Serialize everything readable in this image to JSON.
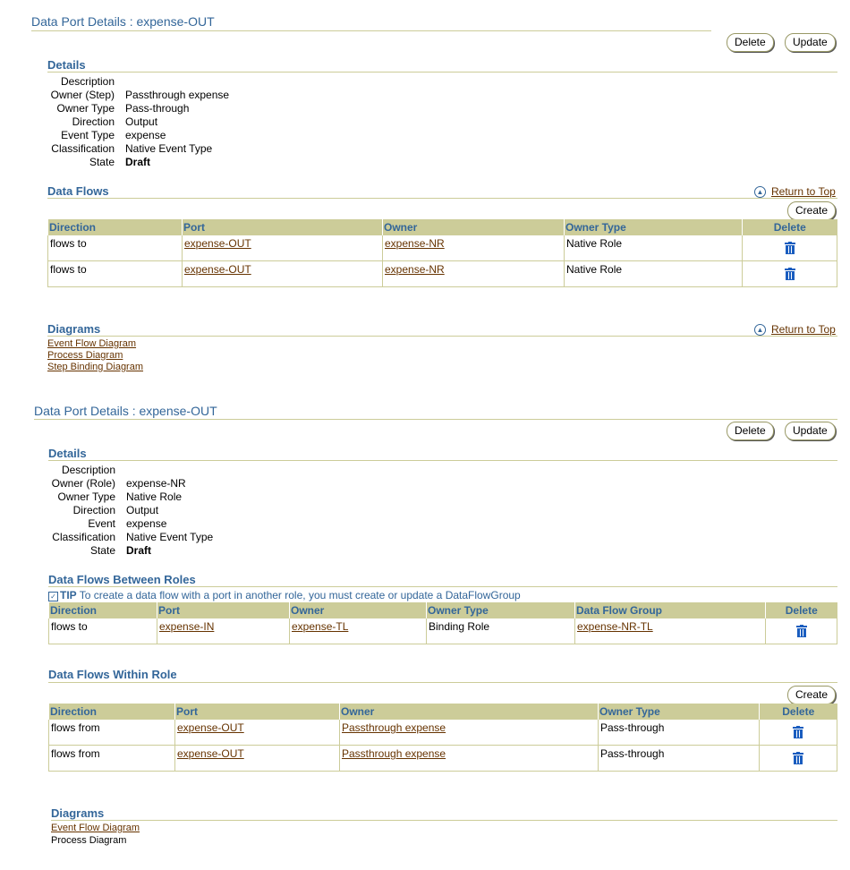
{
  "section1": {
    "page_title": "Data Port Details : expense-OUT",
    "delete_button": "Delete",
    "update_button": "Update",
    "details_title": "Details",
    "details": [
      {
        "label": "Description",
        "value": ""
      },
      {
        "label": "Owner (Step)",
        "value": "Passthrough expense"
      },
      {
        "label": "Owner Type",
        "value": "Pass-through"
      },
      {
        "label": "Direction",
        "value": "Output"
      },
      {
        "label": "Event Type",
        "value": "expense"
      },
      {
        "label": "Classification",
        "value": "Native Event Type"
      },
      {
        "label": "State",
        "value": "Draft"
      }
    ],
    "data_flows_title": "Data Flows",
    "return_to_top": "Return to Top",
    "create_button": "Create",
    "columns": [
      "Direction",
      "Port",
      "Owner",
      "Owner Type",
      "Delete"
    ],
    "rows": [
      {
        "direction": "flows to",
        "port": "expense-OUT",
        "owner": "expense-NR",
        "owner_type": "Native Role"
      },
      {
        "direction": "flows to",
        "port": "expense-OUT",
        "owner": "expense-NR",
        "owner_type": "Native Role"
      }
    ],
    "diagrams_title": "Diagrams",
    "diagrams_return_to_top": "Return to Top",
    "diagram_links": [
      "Event Flow Diagram",
      "Process Diagram",
      "Step Binding Diagram"
    ]
  },
  "section2": {
    "page_title": "Data Port Details : expense-OUT",
    "delete_button": "Delete",
    "update_button": "Update",
    "details_title": "Details",
    "details": [
      {
        "label": "Description",
        "value": ""
      },
      {
        "label": "Owner (Role)",
        "value": "expense-NR"
      },
      {
        "label": "Owner Type",
        "value": "Native Role"
      },
      {
        "label": "Direction",
        "value": "Output"
      },
      {
        "label": "Event",
        "value": "expense"
      },
      {
        "label": "Classification",
        "value": "Native Event Type"
      },
      {
        "label": "State",
        "value": "Draft"
      }
    ],
    "between_title": "Data Flows Between Roles",
    "tip_label": "TIP",
    "tip_text": "To create a data flow with a port in another role, you must create or update a DataFlowGroup",
    "between_columns": [
      "Direction",
      "Port",
      "Owner",
      "Owner Type",
      "Data Flow Group",
      "Delete"
    ],
    "between_rows": [
      {
        "direction": "flows to",
        "port": "expense-IN",
        "owner": "expense-TL",
        "owner_type": "Binding Role",
        "group": "expense-NR-TL"
      }
    ],
    "within_title": "Data Flows Within Role",
    "create_button": "Create",
    "within_columns": [
      "Direction",
      "Port",
      "Owner",
      "Owner Type",
      "Delete"
    ],
    "within_rows": [
      {
        "direction": "flows from",
        "port": "expense-OUT",
        "owner": "Passthrough expense",
        "owner_type": "Pass-through"
      },
      {
        "direction": "flows from",
        "port": "expense-OUT",
        "owner": "Passthrough expense",
        "owner_type": "Pass-through"
      }
    ],
    "diagrams_title": "Diagrams",
    "diagram_link": "Event Flow Diagram",
    "diagram_text": "Process Diagram"
  },
  "colors": {
    "accent": "#336699",
    "header_bg": "#cccc99",
    "link": "#663300",
    "trash": "#1a5dbf"
  }
}
